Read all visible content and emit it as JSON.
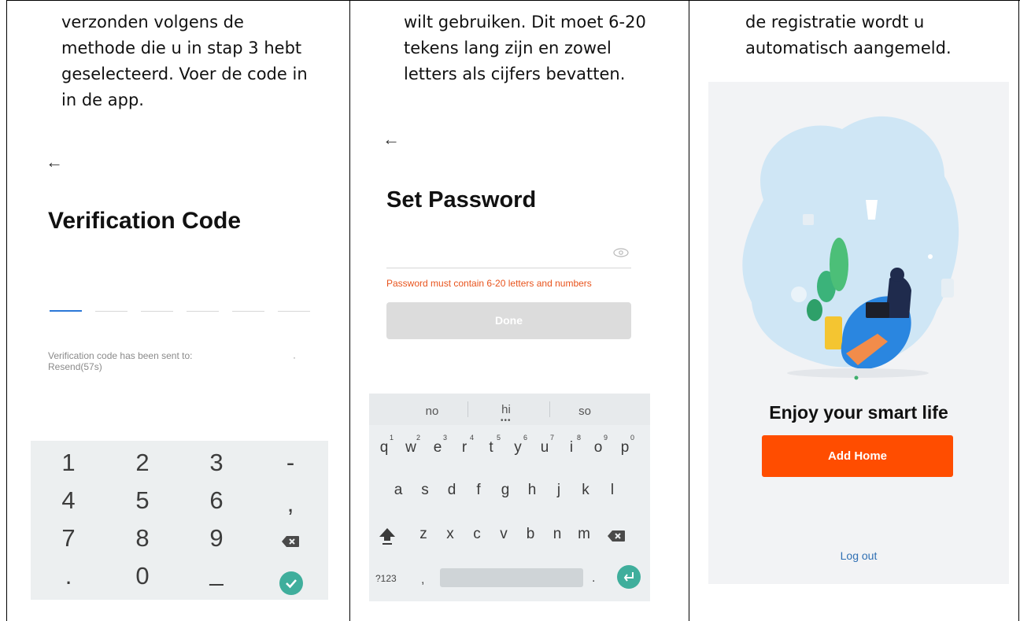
{
  "columns": [
    {
      "intro": "verzonden volgens de\nmethode die u in stap 3 hebt\ngeselecteerd.  Voer de code in\nin de app.",
      "screen": {
        "back_glyph": "←",
        "title": "Verification Code",
        "sent_to": "Verification code has been sent to:",
        "resend": "Resend(57s)",
        "numpad": [
          "1",
          "2",
          "3",
          "-",
          "4",
          "5",
          "6",
          ",",
          "7",
          "8",
          "9",
          "⌫",
          ".",
          "0",
          "_",
          "✓"
        ]
      }
    },
    {
      "intro": "wilt gebruiken. Dit moet 6-20\ntekens lang zijn en zowel\nletters als cijfers bevatten.",
      "screen": {
        "back_glyph": "←",
        "title": "Set Password",
        "warning": "Password must contain 6-20 letters and numbers",
        "done_label": "Done",
        "suggestions": [
          "no",
          "hi",
          "so"
        ],
        "row1": [
          "q",
          "w",
          "e",
          "r",
          "t",
          "y",
          "u",
          "i",
          "o",
          "p"
        ],
        "row1_nums": [
          "1",
          "2",
          "3",
          "4",
          "5",
          "6",
          "7",
          "8",
          "9",
          "0"
        ],
        "row2": [
          "a",
          "s",
          "d",
          "f",
          "g",
          "h",
          "j",
          "k",
          "l"
        ],
        "row3": [
          "z",
          "x",
          "c",
          "v",
          "b",
          "n",
          "m"
        ],
        "sym_key": "?123",
        "comma_key": ",",
        "period_key": "."
      }
    },
    {
      "intro": "de registratie wordt u\nautomatisch aangemeld.",
      "screen": {
        "headline": "Enjoy your smart life",
        "add_home": "Add Home",
        "logout": "Log out"
      }
    }
  ],
  "colors": {
    "accent_orange": "#ff4d00",
    "confirm_teal": "#3fae9c",
    "link_blue": "#2f6fb3"
  }
}
